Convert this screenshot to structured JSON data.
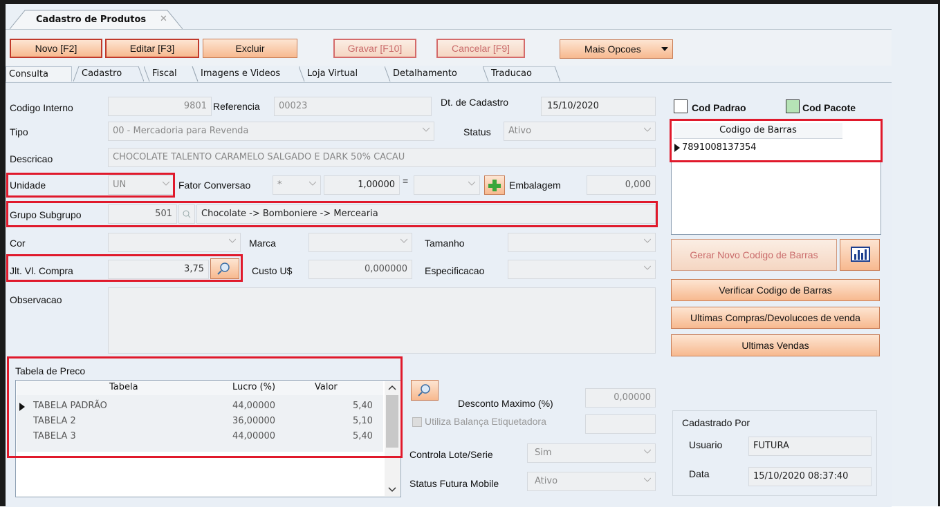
{
  "window": {
    "tab_title": "Cadastro de Produtos",
    "tab_close": "✕"
  },
  "toolbar": {
    "novo": "Novo [F2]",
    "editar": "Editar [F3]",
    "excluir": "Excluir",
    "gravar": "Gravar [F10]",
    "cancelar": "Cancelar [F9]",
    "mais": "Mais Opcoes"
  },
  "tabs": [
    "Consulta",
    "Cadastro",
    "Fiscal",
    "Imagens e Videos",
    "Loja Virtual",
    "Detalhamento",
    "Traducao"
  ],
  "form": {
    "codigo_label": "Codigo Interno",
    "codigo_value": "9801",
    "referencia_label": "Referencia",
    "referencia_value": "00023",
    "dt_label": "Dt. de Cadastro",
    "dt_value": "15/10/2020",
    "tipo_label": "Tipo",
    "tipo_value": "00 - Mercadoria para Revenda",
    "status_label": "Status",
    "status_value": "Ativo",
    "descricao_label": "Descricao",
    "descricao_value": "CHOCOLATE TALENTO CARAMELO SALGADO E DARK 50% CACAU",
    "unidade_label": "Unidade",
    "unidade_value": "UN",
    "fator_label": "Fator Conversao",
    "fator_op": "*",
    "fator_value": "1,00000",
    "equals": "=",
    "embalagem_label": "Embalagem",
    "embalagem_value": "0,000",
    "grupo_label": "Grupo Subgrupo",
    "grupo_code": "501",
    "grupo_desc": "Chocolate -> Bomboniere -> Mercearia",
    "cor_label": "Cor",
    "marca_label": "Marca",
    "tamanho_label": "Tamanho",
    "ult_label": "Ult. Vl. Compra",
    "ult_label_visible": "Jlt. Vl. Compra",
    "ult_value": "3,75",
    "custo_label": "Custo U$",
    "custo_value": "0,000000",
    "espec_label": "Especificacao",
    "obs_label": "Observacao"
  },
  "barcode": {
    "cod_padrao": "Cod Padrao",
    "cod_pacote": "Cod Pacote",
    "header": "Codigo de Barras",
    "value": "7891008137354",
    "gerar": "Gerar Novo Codigo de Barras",
    "verificar": "Verificar Codigo de Barras",
    "ultimas_compras": "Ultimas Compras/Devolucoes de venda",
    "ultimas_vendas": "Ultimas Vendas"
  },
  "preco": {
    "group_label": "Tabela de Preco",
    "columns": [
      "Tabela",
      "Lucro (%)",
      "Valor"
    ],
    "rows": [
      {
        "tabela": "TABELA PADRÃO",
        "lucro": "44,00000",
        "valor": "5,40"
      },
      {
        "tabela": "TABELA 2",
        "lucro": "36,00000",
        "valor": "5,10"
      },
      {
        "tabela": "TABELA 3",
        "lucro": "44,00000",
        "valor": "5,40"
      }
    ]
  },
  "lower": {
    "desconto_label": "Desconto Maximo (%)",
    "desconto_value": "0,00000",
    "balanca_label": "Utiliza Balança Etiquetadora",
    "lote_label": "Controla Lote/Serie",
    "lote_value": "Sim",
    "mobile_label": "Status Futura Mobile",
    "mobile_value": "Ativo"
  },
  "cadastrado": {
    "title": "Cadastrado Por",
    "usuario_label": "Usuario",
    "usuario_value": "FUTURA",
    "data_label": "Data",
    "data_value": "15/10/2020 08:37:40"
  },
  "colors": {
    "accent_red": "#e0192b",
    "button_fill": "#f7b98f",
    "green_plus": "#3aa63a"
  }
}
